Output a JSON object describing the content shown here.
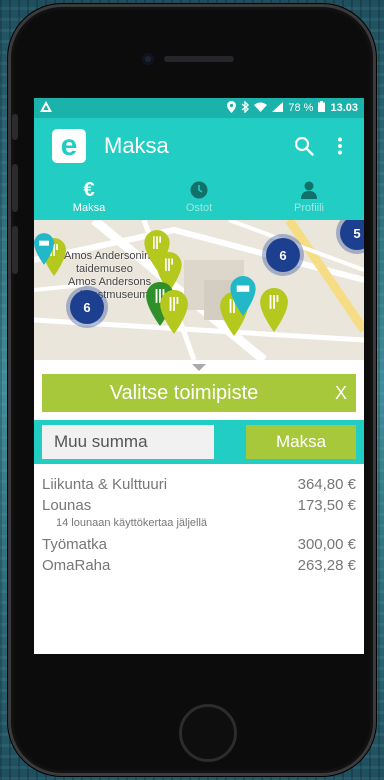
{
  "status_bar": {
    "battery": "78 %",
    "time": "13.03"
  },
  "app_bar": {
    "logo_letter": "e",
    "title": "Maksa"
  },
  "tabs": [
    {
      "label": "Maksa",
      "icon": "euro-icon",
      "active": true
    },
    {
      "label": "Ostot",
      "icon": "clock-icon",
      "active": false
    },
    {
      "label": "Profiili",
      "icon": "person-icon",
      "active": false
    }
  ],
  "map": {
    "labels": [
      "Amos Andersonin",
      "taidemuseo",
      "Amos Andersons",
      "konstmuseum"
    ],
    "clusters": [
      "6",
      "6",
      "5"
    ],
    "colors": {
      "pin": "#b4c81e",
      "cluster": "#1d3f8f"
    }
  },
  "select_location": {
    "label": "Valitse toimipiste",
    "close": "X"
  },
  "payment": {
    "amount_placeholder": "Muu summa",
    "pay_label": "Maksa"
  },
  "balances": [
    {
      "name": "Liikunta & Kulttuuri",
      "amount": "364,80 €"
    },
    {
      "name": "Lounas",
      "amount": "173,50 €",
      "note": "14 lounaan käyttökertaa jäljellä"
    },
    {
      "name": "Työmatka",
      "amount": "300,00 €"
    },
    {
      "name": "OmaRaha",
      "amount": "263,28 €"
    }
  ],
  "colors": {
    "accent": "#22cdc3",
    "status": "#1ab2aa",
    "green": "#a7c83b"
  }
}
